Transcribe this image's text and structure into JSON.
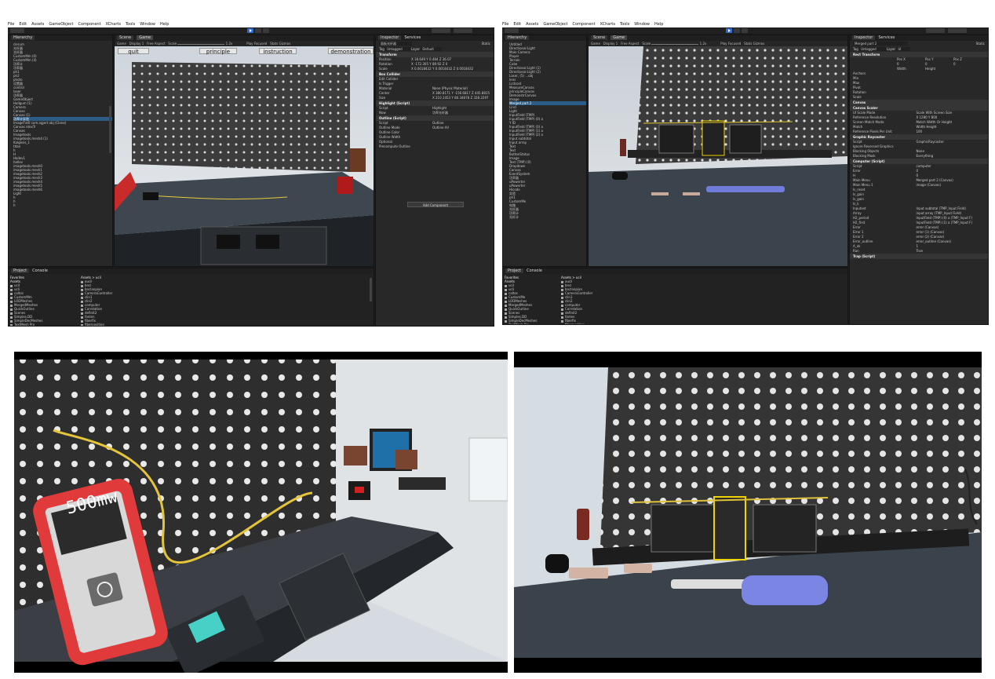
{
  "menu": [
    "File",
    "Edit",
    "Assets",
    "GameObject",
    "Component",
    "XCharts",
    "Tools",
    "Window",
    "Help"
  ],
  "left_editor": {
    "hierarchy_tab": "Hierarchy",
    "scene_tab": "Scene",
    "game_tab": "Game",
    "game_bar": {
      "mode": "Game",
      "display": "Display 1",
      "aspect": "Free Aspect",
      "scale_label": "Scale",
      "scale_value": "1.2x",
      "play_focused": "Play Focused",
      "stats": "Stats",
      "gizmos": "Gizmos"
    },
    "game_buttons": [
      "quit",
      "principle",
      "instruction",
      "demonstration"
    ],
    "hierarchy_items": [
      "clerum",
      "光纤器",
      "光纤器",
      "CustomMm (0)",
      "CustomMm (4)",
      "功率计",
      "功率器",
      "ph1",
      "ph2",
      "photo",
      "设置器",
      "control",
      "laser",
      "功率器",
      "GameObject",
      "Hallgum (1)",
      "Camera",
      "Canvas",
      "Canvas (1)",
      "功率计实验",
      "ImageTxt0 com.ogjert.obj (Clone)",
      "Canvas ntexTr",
      "Canvas",
      "Imagetools",
      "imagetools.mesh4 (1)",
      "Kalgesis_1",
      "titan",
      "h",
      "H",
      "Hallev1",
      "hallev",
      "imagetools.mesh0",
      "imagetools.mesh1",
      "imagetools.mesh2",
      "imagetools.mesh3",
      "imagetools.mesh4",
      "imagetools.mesh5",
      "imagetools.mesh6",
      "Light",
      "h",
      "h",
      "h"
    ],
    "inspector_tab": "Inspector",
    "services_tab": "Services",
    "object_name": "面板光纤器",
    "static_label": "Static",
    "tag_label": "Tag",
    "tag_value": "Untagged",
    "layer_label": "Layer",
    "layer_value": "Default",
    "transform": {
      "title": "Transform",
      "position_label": "Position",
      "position": [
        "X 18.649",
        "Y 0.484",
        "Z 36.07"
      ],
      "rotation_label": "Rotation",
      "rotation": [
        "X -172.305",
        "Y 89.92",
        "Z 0"
      ],
      "scale_label": "Scale",
      "scale": [
        "X 0.0018432",
        "Y 0.0018432",
        "Z 0.0018432"
      ]
    },
    "box_collider": {
      "title": "Box Collider",
      "rows": [
        [
          "Edit Collider",
          ""
        ],
        [
          "Is Trigger",
          ""
        ],
        [
          "Material",
          "None (Physic Material)"
        ],
        [
          "Center",
          "X 380.8171  Y -156.6817  Z 445.8815"
        ],
        [
          "Size",
          "X 210.1453  Y 80.34878  Z 328.2297"
        ]
      ]
    },
    "highlight": {
      "title": "Highlight (Script)",
      "rows": [
        [
          "Script",
          "Highlight"
        ],
        [
          "Now",
          "功率光纤器"
        ]
      ]
    },
    "outline": {
      "title": "Outline (Script)",
      "rows": [
        [
          "Script",
          "Outline"
        ],
        [
          "Outline Mode",
          "Outline All"
        ],
        [
          "Outline Color",
          ""
        ],
        [
          "Outline Width",
          ""
        ],
        [
          "Optional",
          ""
        ],
        [
          "Precompute Outline",
          ""
        ]
      ]
    },
    "add_component": "Add Component",
    "project_tab": "Project",
    "console_tab": "Console",
    "favorites": "Favorites",
    "assets": "Assets",
    "folder_tree": [
      "ucil",
      "ucli",
      "caltos",
      "CustomMm",
      "LODMeshes",
      "MergedMeshes",
      "QuickOutline",
      "Scenes",
      "Simples.DD",
      "SimpleDecMeshes",
      "TextMesh Pro",
      "XCharts"
    ],
    "breadcrumb": "Assets > ucil",
    "asset_list": [
      "aucil",
      "bnci",
      "bnclanpian",
      "CameraController",
      "clin1",
      "clin2",
      "computer",
      "Correlation",
      "definit2",
      "fanlen",
      "fiberfix",
      "fiberposition",
      "fibername"
    ]
  },
  "right_editor": {
    "object_name": "Merged part 2",
    "static_label": "Static",
    "tag_value": "Untagged",
    "layer_value": "UI",
    "rect_transform": "Rect Transform",
    "rect_rows": [
      [
        "Pos X",
        "Pos Y",
        "Pos Z"
      ],
      [
        "0",
        "0",
        "0"
      ],
      [
        "Width",
        "Height",
        ""
      ]
    ],
    "anchors": [
      "Anchors",
      "Min",
      "Max",
      "Pivot",
      "Rotation",
      "Scale"
    ],
    "canvas": "Canvas",
    "canvas_scaler": "Canvas Scaler",
    "scaler_rows": [
      [
        "UI Scale Mode",
        "Scale With Screen Size"
      ],
      [
        "Reference Resolution",
        "X 1280  Y 800"
      ],
      [
        "Screen Match Mode",
        "Match Width Or Height"
      ],
      [
        "Match",
        "Width   Height"
      ],
      [
        "Reference Pixels Per Unit",
        "100"
      ]
    ],
    "graphic_raycaster": "Graphic Raycaster",
    "raycaster_rows": [
      [
        "Script",
        "GraphicRaycaster"
      ],
      [
        "Ignore Reversed Graphics",
        ""
      ],
      [
        "Blocking Objects",
        "None"
      ],
      [
        "Blocking Mask",
        "Everything"
      ]
    ],
    "computer_script": "Computer (Script)",
    "computer_rows": [
      [
        "Script",
        "computer"
      ],
      [
        "Error",
        "0"
      ],
      [
        "H",
        "0"
      ],
      [
        "Main Menu",
        "Merged part 2 (Canvas)"
      ],
      [
        "Main Menu 1",
        "image (Canvas)"
      ],
      [
        "Is_reset",
        ""
      ],
      [
        "Is_gain",
        ""
      ],
      [
        "Is_gain",
        ""
      ],
      [
        "Is_k",
        ""
      ],
      [
        "Inputset",
        "Input subtotal (TMP_Input Field)"
      ],
      [
        "Array",
        "input array (TMP_Input Field)"
      ],
      [
        "H2_period",
        "InputField (TMP) (0) a (TMP_Input F)"
      ],
      [
        "H2_first",
        "InputField (TMP) (1) a (TMP_Input F)"
      ],
      [
        "Error",
        "error (Canvas)"
      ],
      [
        "Error 1",
        "error (1) (Canvas)"
      ],
      [
        "Error 2",
        "error (2) (Canvas)"
      ],
      [
        "Error_outline",
        "error_outline (Canvas)"
      ],
      [
        "A_ok",
        "1"
      ],
      [
        "Ran",
        "True"
      ]
    ],
    "trap_script": "Trap (Script)",
    "hierarchy_items": [
      "Untitled",
      "Directional Light",
      "Main Camera",
      "Player",
      "Terrain",
      "Cube",
      "Directional Light (1)",
      "Directional Light (2)",
      "Laser, (5) ...obj",
      "lens",
      "Lcdcost",
      "MeasureCanvas",
      "principleCanvas",
      "DemonstrCanvas",
      "Image",
      "Merged part 2",
      "Lincl",
      "Light",
      "InputField (TMP)",
      "InputField (TMP) (0) a",
      "Y ID",
      "InputField (TMP) (0) a",
      "InputField (TMP) (1) a",
      "InputField (TMP) (2) a",
      "Input subtotal",
      "Input array",
      "Text",
      "Text",
      "ButtonStatus",
      "Image",
      "Text (TMP) (0)",
      "Dropdown",
      "Canvas",
      "EventSystem",
      "功率器",
      "uPowerter",
      "uPowerter",
      "Hicode",
      "实验",
      "ph1",
      "CustomMe",
      "电路",
      "光纤器",
      "功率计",
      "光纤计"
    ],
    "folder_tree": [
      "ucil",
      "ucli",
      "caltos",
      "CustomMe",
      "LODMeshes",
      "MergedMeshes",
      "QuickOutline",
      "Scenes",
      "Simples.DD",
      "SimpleDecMeshes",
      "TextMesh Pro",
      "XCharts",
      "XChartsDemo"
    ],
    "asset_list": [
      "aucil",
      "bnci",
      "bnclanpian",
      "CameraController",
      "clin1",
      "clin2",
      "computer",
      "Correlation",
      "definit2",
      "fanlen",
      "fiberfix",
      "fiberposition",
      "fibername",
      "fiberlid"
    ]
  },
  "photo_left": {
    "meter_reading": "500mw"
  }
}
